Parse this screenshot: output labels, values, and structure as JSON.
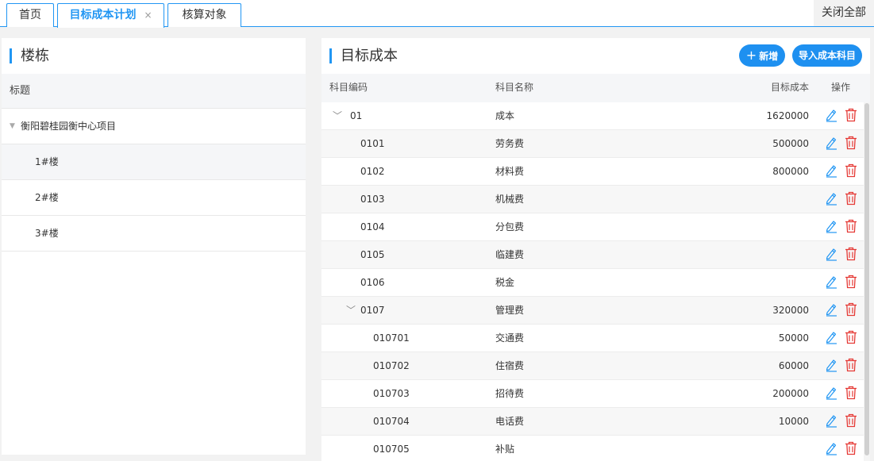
{
  "tabs": [
    {
      "label": "首页",
      "closable": false
    },
    {
      "label": "目标成本计划",
      "closable": true,
      "close": "×"
    },
    {
      "label": "核算对象",
      "closable": false
    }
  ],
  "close_all": "关闭全部",
  "left": {
    "title": "楼栋",
    "header": "标题",
    "tree": [
      {
        "label": "衡阳碧桂园衡中心项目",
        "level": 0,
        "expanded": true
      },
      {
        "label": "1#楼",
        "level": 1,
        "selected": true
      },
      {
        "label": "2#楼",
        "level": 1
      },
      {
        "label": "3#楼",
        "level": 1
      }
    ]
  },
  "right": {
    "title": "目标成本",
    "add_button": "新增",
    "import_button": "导入成本科目",
    "columns": {
      "code": "科目编码",
      "name": "科目名称",
      "target": "目标成本",
      "ops": "操作"
    },
    "rows": [
      {
        "code": "01",
        "name": "成本",
        "target": "1620000",
        "level": 0,
        "expandable": true
      },
      {
        "code": "0101",
        "name": "劳务费",
        "target": "500000",
        "level": 1
      },
      {
        "code": "0102",
        "name": "材料费",
        "target": "800000",
        "level": 1
      },
      {
        "code": "0103",
        "name": "机械费",
        "target": "",
        "level": 1
      },
      {
        "code": "0104",
        "name": "分包费",
        "target": "",
        "level": 1
      },
      {
        "code": "0105",
        "name": "临建费",
        "target": "",
        "level": 1
      },
      {
        "code": "0106",
        "name": "税金",
        "target": "",
        "level": 1
      },
      {
        "code": "0107",
        "name": "管理费",
        "target": "320000",
        "level": 1,
        "expandable": true
      },
      {
        "code": "010701",
        "name": "交通费",
        "target": "50000",
        "level": 2
      },
      {
        "code": "010702",
        "name": "住宿费",
        "target": "60000",
        "level": 2
      },
      {
        "code": "010703",
        "name": "招待费",
        "target": "200000",
        "level": 2
      },
      {
        "code": "010704",
        "name": "电话费",
        "target": "10000",
        "level": 2
      },
      {
        "code": "010705",
        "name": "补贴",
        "target": "",
        "level": 2
      }
    ]
  },
  "colors": {
    "accent": "#2196f3",
    "delete": "#e53935",
    "edit": "#2196f3"
  },
  "icons": {
    "edit": "pencil-icon",
    "delete": "trash-icon",
    "expand": "chevron-down-icon",
    "add": "plus-icon"
  }
}
